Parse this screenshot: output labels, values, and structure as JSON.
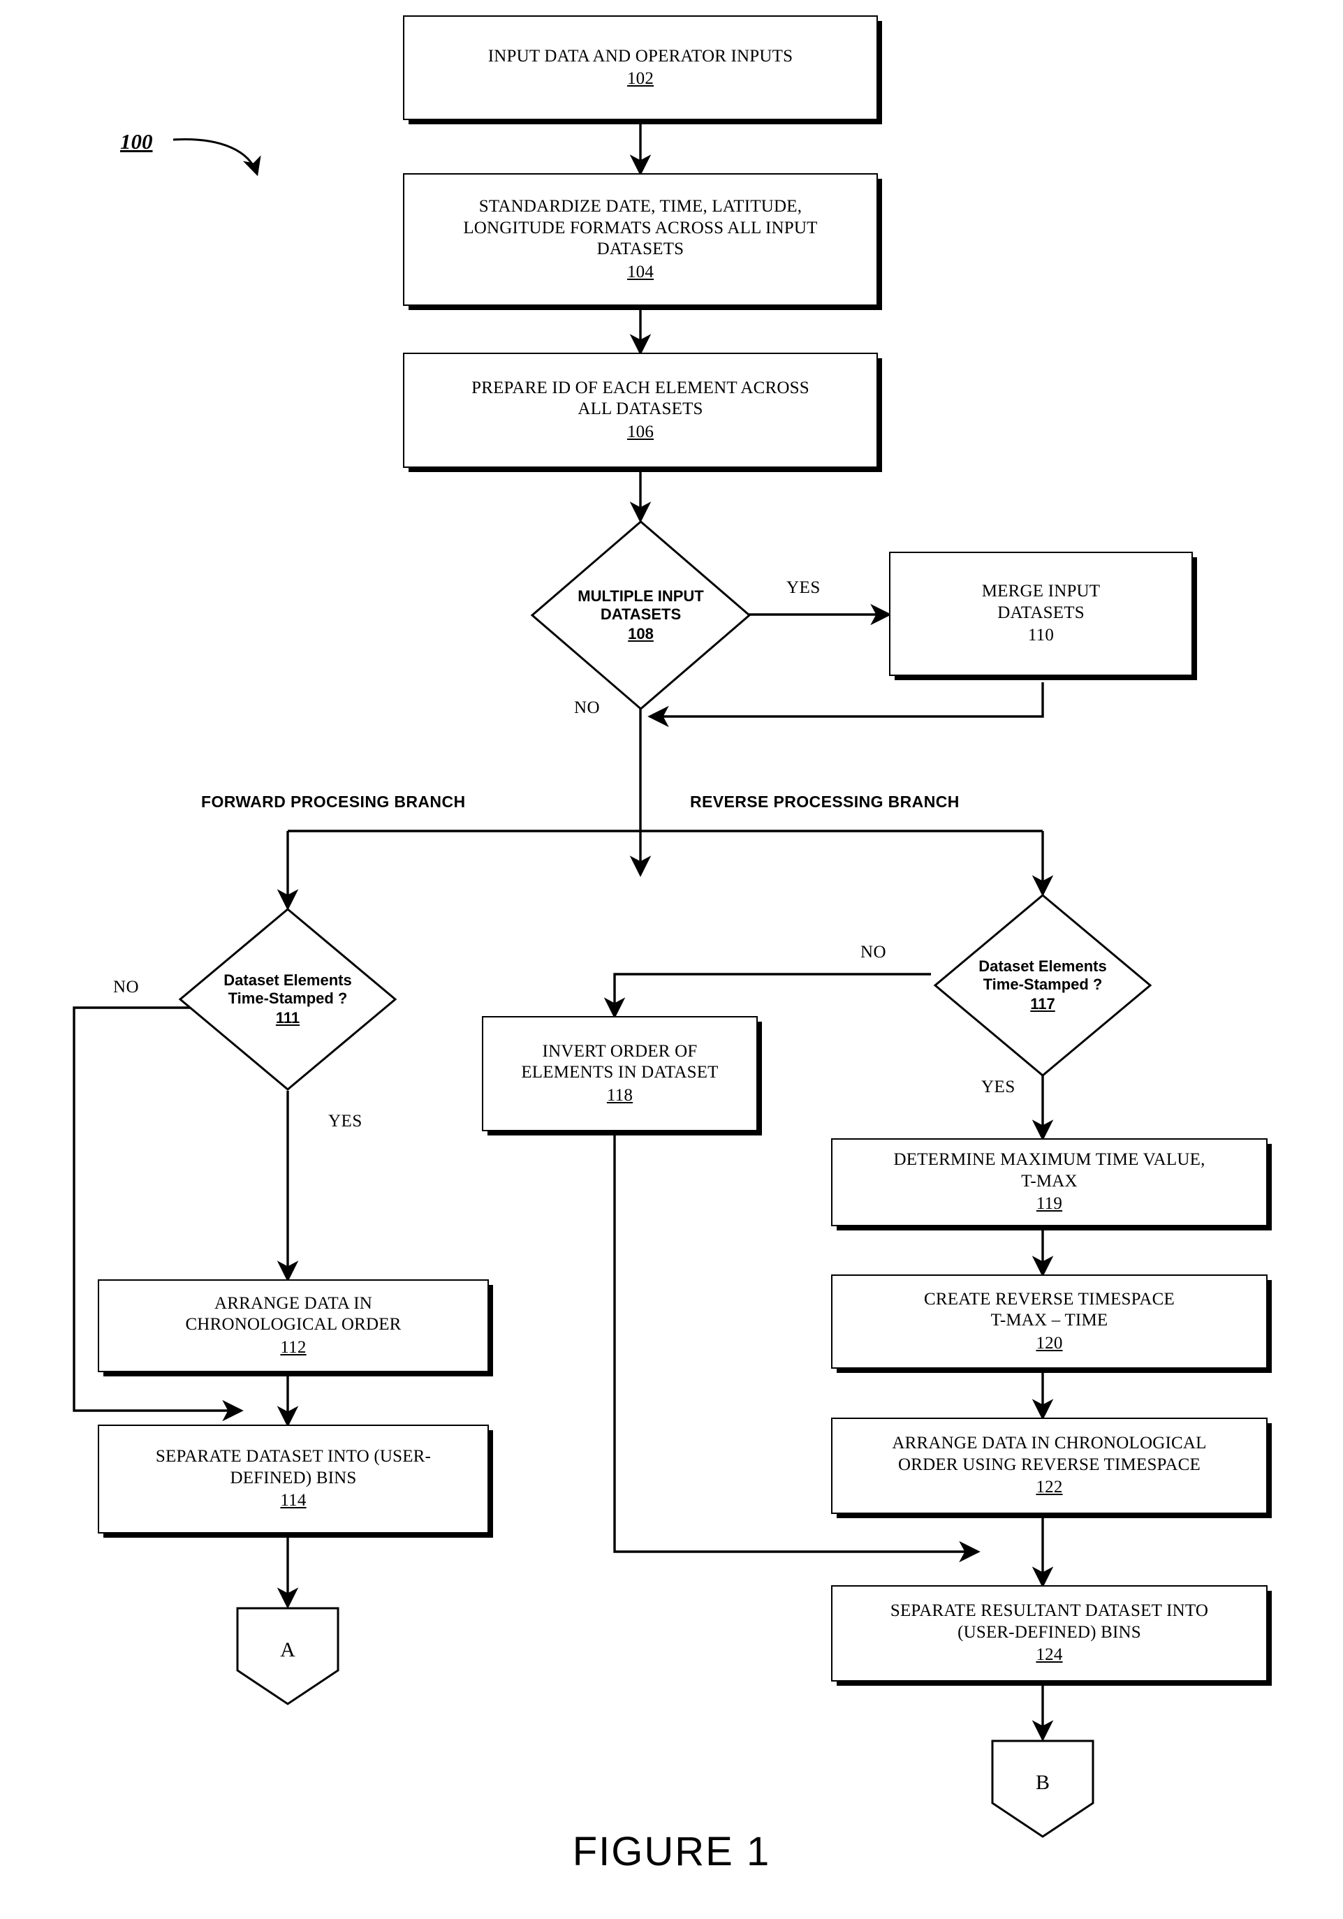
{
  "figure": {
    "caption": "FIGURE 1",
    "reference_numeral": "100"
  },
  "branch_headings": {
    "forward": "FORWARD  PROCESING BRANCH",
    "reverse": "REVERSE PROCESSING BRANCH"
  },
  "nodes": {
    "n102": {
      "line1": "INPUT DATA AND OPERATOR INPUTS",
      "num": "102"
    },
    "n104": {
      "line1": "STANDARDIZE DATE, TIME, LATITUDE,",
      "line2": "LONGITUDE FORMATS ACROSS ALL INPUT",
      "line3": "DATASETS",
      "num": "104"
    },
    "n106": {
      "line1": "PREPARE ID OF EACH ELEMENT ACROSS",
      "line2": "ALL DATASETS",
      "num": "106"
    },
    "n108": {
      "line1": "MULTIPLE INPUT",
      "line2": "DATASETS",
      "num": "108"
    },
    "n110": {
      "line1": "MERGE INPUT",
      "line2": "DATASETS",
      "num": "110"
    },
    "n111": {
      "line1": "Dataset Elements",
      "line2": "Time-Stamped ?",
      "num": "111"
    },
    "n112": {
      "line1": "ARRANGE DATA IN",
      "line2": "CHRONOLOGICAL ORDER",
      "num": "112"
    },
    "n114": {
      "line1": "SEPARATE DATASET  INTO (USER-",
      "line2": "DEFINED) BINS",
      "num": "114"
    },
    "n117": {
      "line1": "Dataset Elements",
      "line2": "Time-Stamped ?",
      "num": "117"
    },
    "n118": {
      "line1": "INVERT ORDER OF",
      "line2": "ELEMENTS IN DATASET",
      "num": "118"
    },
    "n119": {
      "line1": "DETERMINE MAXIMUM TIME VALUE,",
      "line2": "T-MAX",
      "num": "119"
    },
    "n120": {
      "line1": "CREATE REVERSE TIMESPACE",
      "line2": "T-MAX – TIME",
      "num": "120"
    },
    "n122": {
      "line1": "ARRANGE DATA IN CHRONOLOGICAL",
      "line2": "ORDER USING REVERSE TIMESPACE",
      "num": "122"
    },
    "n124": {
      "line1": "SEPARATE RESULTANT DATASET  INTO",
      "line2": "(USER-DEFINED) BINS",
      "num": "124"
    },
    "connector_a": {
      "label": "A"
    },
    "connector_b": {
      "label": "B"
    }
  },
  "edge_labels": {
    "e108_yes": "YES",
    "e108_no": "NO",
    "e111_no": "NO",
    "e111_yes": "YES",
    "e117_no": "NO",
    "e117_yes": "YES"
  },
  "colors": {
    "stroke": "#000000",
    "fill": "#ffffff"
  }
}
